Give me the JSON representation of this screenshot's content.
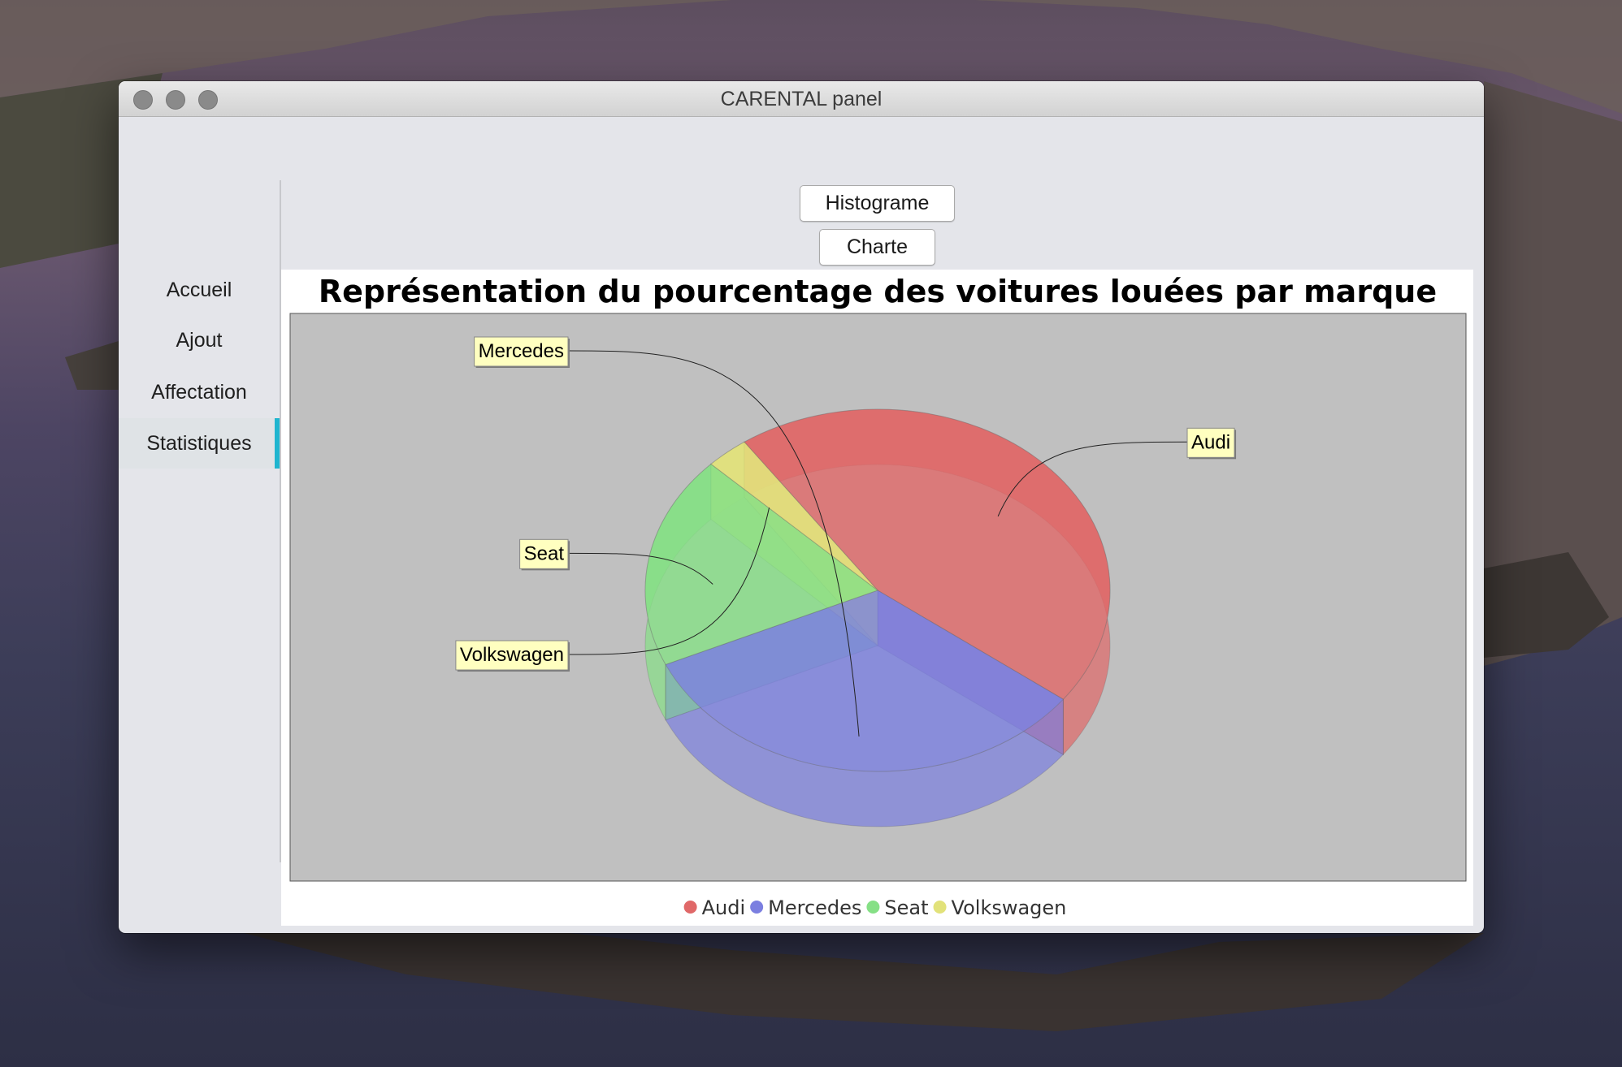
{
  "window": {
    "title": "CARENTAL panel"
  },
  "sidebar": {
    "items": [
      {
        "label": "Accueil",
        "active": false
      },
      {
        "label": "Ajout",
        "active": false
      },
      {
        "label": "Affectation",
        "active": false
      },
      {
        "label": "Statistiques",
        "active": true
      }
    ],
    "accent_color": "#1fb5cf"
  },
  "toolbar": {
    "histogram_label": "Histograme",
    "chart_label": "Charte"
  },
  "chart_data": {
    "type": "pie",
    "title": "Représentation du pourcentage des voitures louées par marque",
    "style": "3d",
    "categories": [
      "Audi",
      "Mercedes",
      "Seat",
      "Volkswagen"
    ],
    "values": [
      45,
      33,
      19,
      3
    ],
    "colors": [
      "#e06868",
      "#7b7fe0",
      "#86e086",
      "#e2e27a"
    ],
    "legend": {
      "position": "bottom",
      "entries": [
        "Audi",
        "Mercedes",
        "Seat",
        "Volkswagen"
      ]
    },
    "plot_background": "#c0c0c0"
  }
}
